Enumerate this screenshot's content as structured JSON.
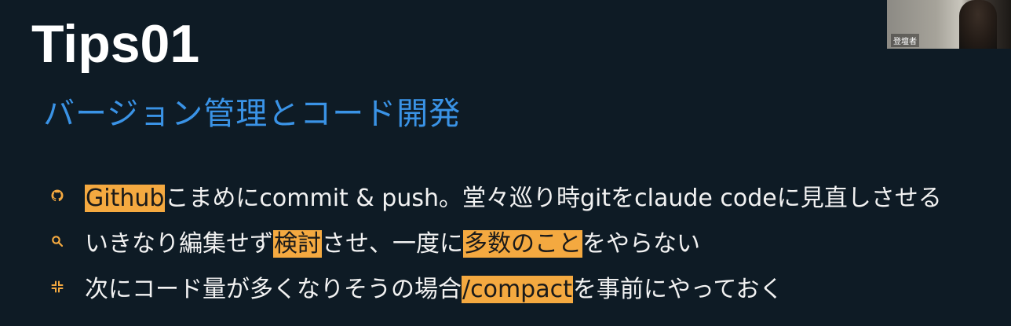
{
  "slide": {
    "title": "Tips01",
    "subtitle": "バージョン管理とコード開発"
  },
  "bullets": [
    {
      "icon": "github-icon",
      "segments": [
        {
          "text": "Github",
          "highlight": true
        },
        {
          "text": "こまめにcommit & push。堂々巡り時gitをclaude codeに見直しさせる",
          "highlight": false
        }
      ]
    },
    {
      "icon": "search-icon",
      "segments": [
        {
          "text": "いきなり編集せず",
          "highlight": false
        },
        {
          "text": "検討",
          "highlight": true
        },
        {
          "text": "させ、一度に",
          "highlight": false
        },
        {
          "text": "多数のこと",
          "highlight": true
        },
        {
          "text": "をやらない",
          "highlight": false
        }
      ]
    },
    {
      "icon": "compress-icon",
      "segments": [
        {
          "text": "次にコード量が多くなりそうの場合",
          "highlight": false
        },
        {
          "text": "/compact",
          "highlight": true
        },
        {
          "text": "を事前にやっておく",
          "highlight": false
        }
      ]
    }
  ],
  "webcam": {
    "label": "登壇者"
  },
  "colors": {
    "background": "#0e1b25",
    "title": "#ffffff",
    "subtitle": "#3a93e6",
    "highlight": "#f4a940",
    "body_text": "#f2f2f2"
  }
}
